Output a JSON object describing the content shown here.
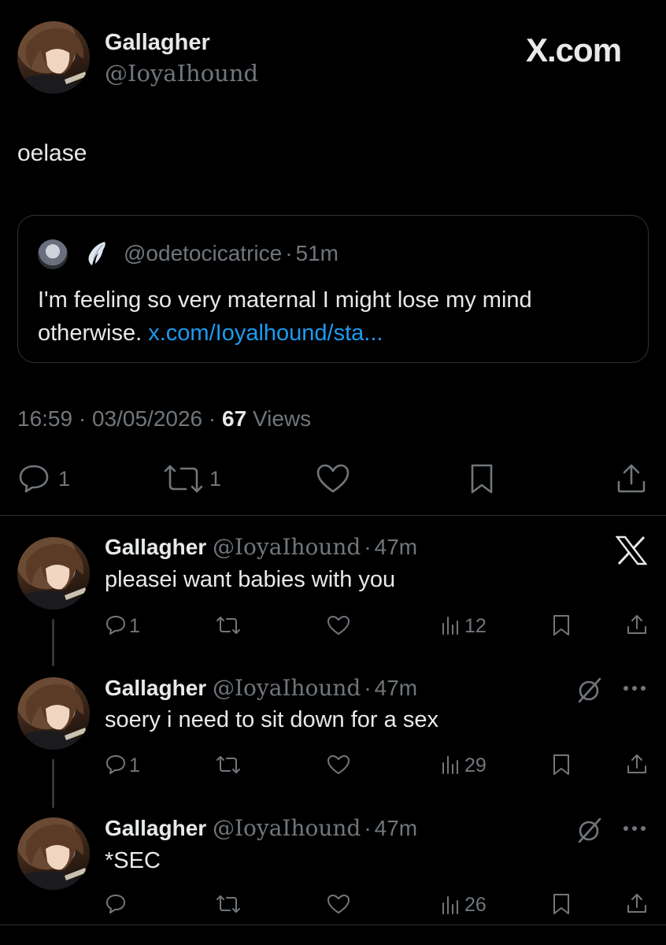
{
  "header": {
    "name": "Gallagher",
    "handle": "@IoyaIhound",
    "watermark": "X.com"
  },
  "main_tweet": {
    "text": "oelase",
    "quote": {
      "handle": "@odetocicatrice",
      "sep": "·",
      "time": "51m",
      "text": "I'm feeling so very maternal I might lose my mind otherwise.",
      "link": "x.com/Ioyalhound/sta..."
    },
    "meta": {
      "time": "16:59",
      "sep1": "·",
      "date": "03/05/2026",
      "sep2": "·",
      "views_count": "67",
      "views_label": "Views"
    },
    "actions": {
      "replies": "1",
      "reposts": "1"
    }
  },
  "replies": [
    {
      "name": "Gallagher",
      "handle": "@IoyaIhound",
      "sep": "·",
      "time": "47m",
      "text": "pleasei want babies with you",
      "replies": "1",
      "views": "12"
    },
    {
      "name": "Gallagher",
      "handle": "@IoyaIhound",
      "sep": "·",
      "time": "47m",
      "text": "soery i need to sit down for a sex",
      "replies": "1",
      "views": "29"
    },
    {
      "name": "Gallagher",
      "handle": "@IoyaIhound",
      "sep": "·",
      "time": "47m",
      "text": "*SEC",
      "replies": "",
      "views": "26"
    }
  ],
  "colors": {
    "background": "#000000",
    "text": "#e7e9ea",
    "muted": "#71767b",
    "link": "#1d9bf0",
    "border": "#2f3336"
  }
}
